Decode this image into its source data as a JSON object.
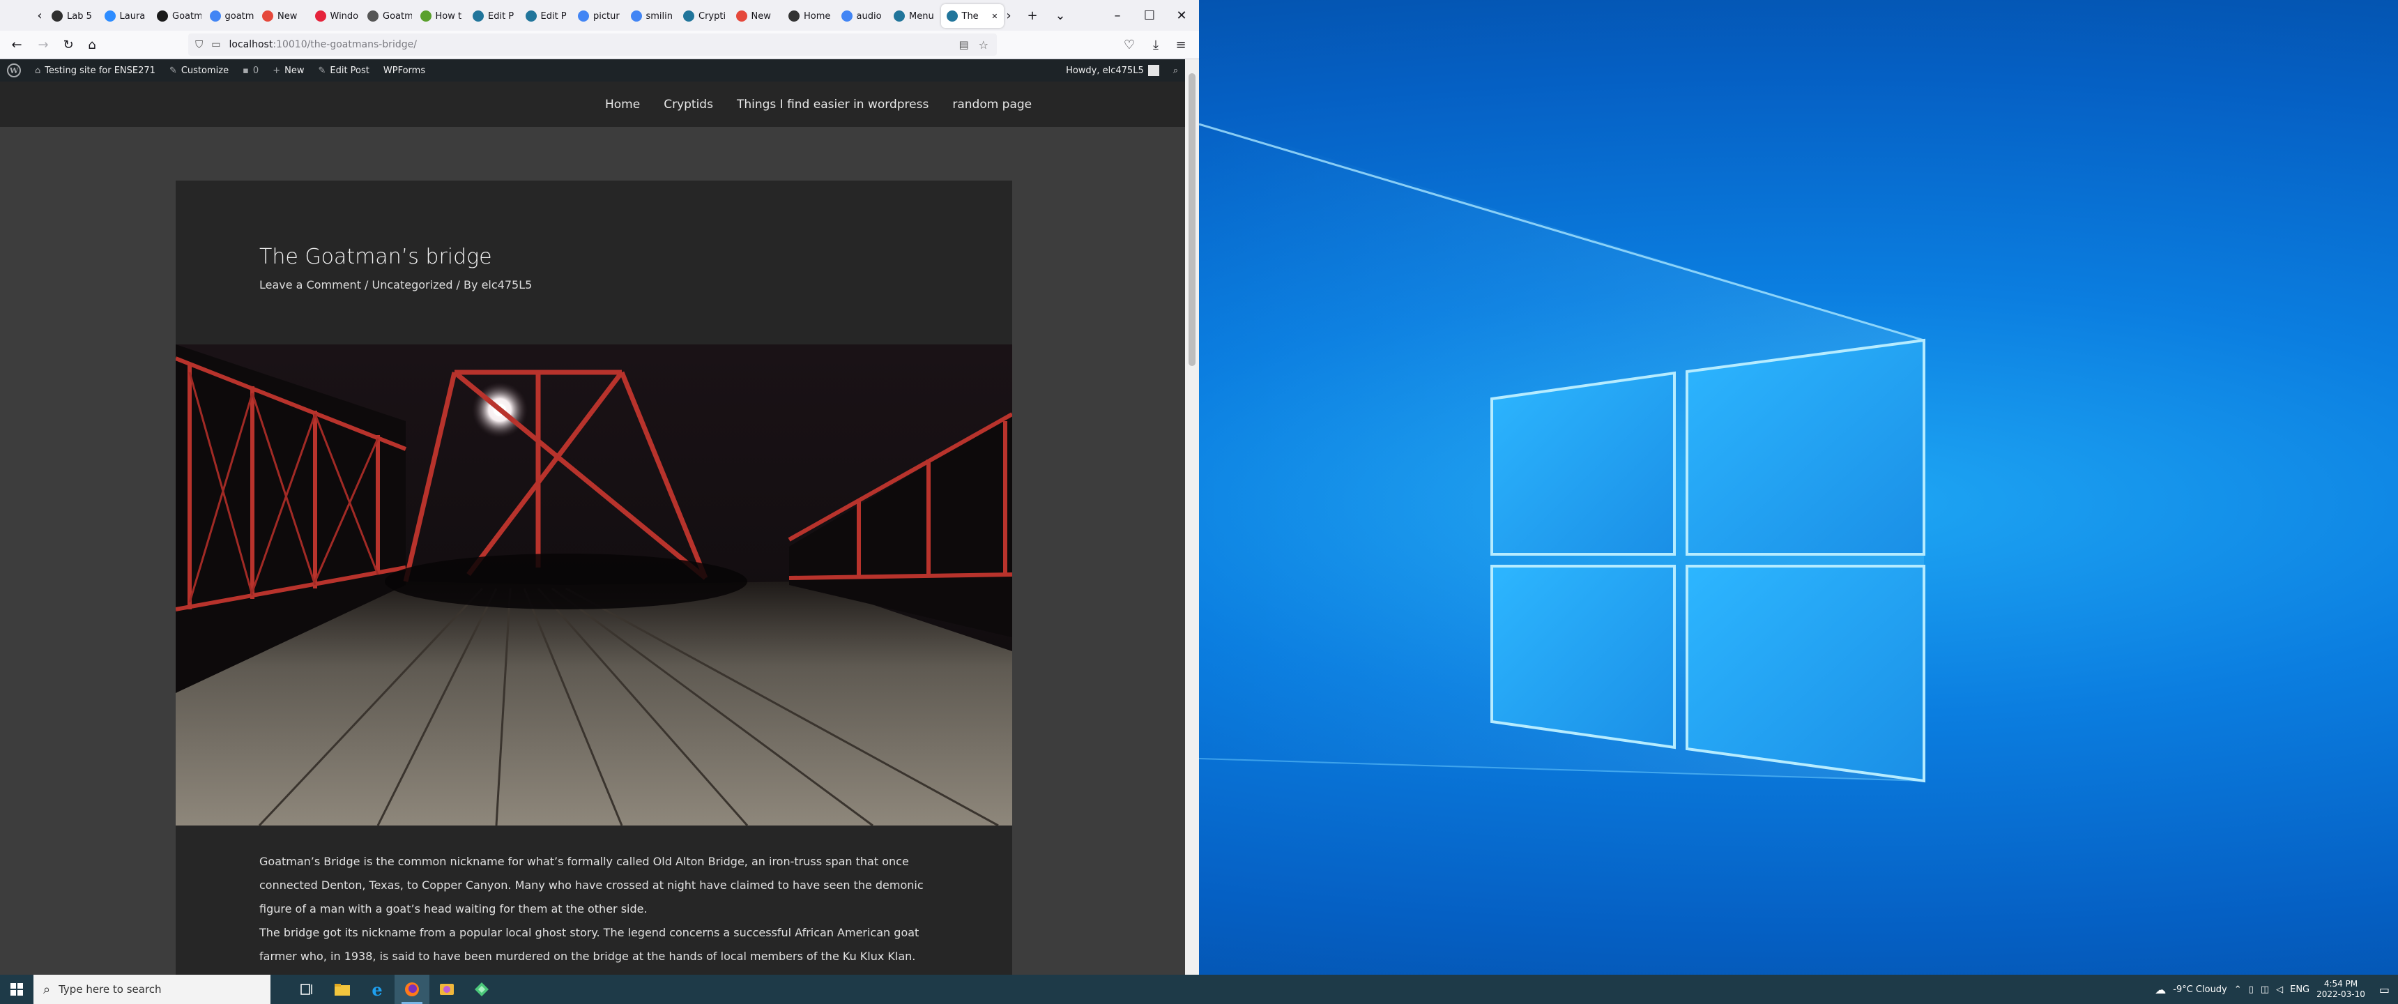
{
  "browser": {
    "tabs": [
      {
        "label": "Lab 5",
        "icon": "lab-icon",
        "color": "#2f2f2f"
      },
      {
        "label": "Laura",
        "icon": "zoom-icon",
        "color": "#2d8cff"
      },
      {
        "label": "Goatm",
        "icon": "cryptid-icon",
        "color": "#1a1a1a"
      },
      {
        "label": "goatm",
        "icon": "google-icon",
        "color": "#4285f4"
      },
      {
        "label": "New",
        "icon": "news-icon",
        "color": "#e5483b"
      },
      {
        "label": "Windo",
        "icon": "opera-icon",
        "color": "#e5233b"
      },
      {
        "label": "Goatm",
        "icon": "wiki-icon",
        "color": "#555"
      },
      {
        "label": "How t",
        "icon": "wikihow-icon",
        "color": "#5aa02c"
      },
      {
        "label": "Edit P",
        "icon": "wordpress-icon",
        "color": "#21759b"
      },
      {
        "label": "Edit P",
        "icon": "wordpress-icon",
        "color": "#21759b"
      },
      {
        "label": "pictur",
        "icon": "google-icon",
        "color": "#4285f4"
      },
      {
        "label": "smilin",
        "icon": "google-icon",
        "color": "#4285f4"
      },
      {
        "label": "Crypti",
        "icon": "wordpress-icon",
        "color": "#21759b"
      },
      {
        "label": "New",
        "icon": "news-icon",
        "color": "#e5483b"
      },
      {
        "label": "Home",
        "icon": "wordpress-icon",
        "color": "#333"
      },
      {
        "label": "audio",
        "icon": "google-icon",
        "color": "#4285f4"
      },
      {
        "label": "Menu",
        "icon": "wordpress-icon",
        "color": "#21759b"
      },
      {
        "label": "The",
        "icon": "wordpress-icon",
        "color": "#21759b",
        "active": true
      }
    ],
    "url_host": "localhost",
    "url_path": ":10010/the-goatmans-bridge/"
  },
  "admin_bar": {
    "site_name": "Testing site for ENSE271",
    "customize": "Customize",
    "comments_count": "0",
    "new": "New",
    "edit_post": "Edit Post",
    "wpforms": "WPForms",
    "howdy": "Howdy, elc475L5"
  },
  "nav": {
    "items": [
      "Home",
      "Cryptids",
      "Things I find easier in wordpress",
      "random page"
    ]
  },
  "post": {
    "title": "The Goatman’s bridge",
    "meta_comment": "Leave a Comment",
    "meta_sep1": " / ",
    "meta_category": "Uncategorized",
    "meta_sep2": " / By ",
    "meta_author": "elc475L5",
    "paragraphs": [
      "Goatman’s Bridge is the common nickname for what’s formally called Old Alton Bridge, an iron-truss span that once connected Denton, Texas, to Copper Canyon. Many who have crossed at night have claimed to have seen the demonic figure of a man with a goat’s head waiting for them at the other side.",
      "The bridge got its nickname from a popular local ghost story. The legend concerns a successful African American goat farmer who, in 1938, is said to have been murdered on the bridge at the hands of local members of the Ku Klux Klan. It’s said that"
    ]
  },
  "taskbar": {
    "search_placeholder": "Type here to search",
    "weather": "-9°C  Cloudy",
    "language": "ENG",
    "time": "4:54 PM",
    "date": "2022-03-10"
  }
}
